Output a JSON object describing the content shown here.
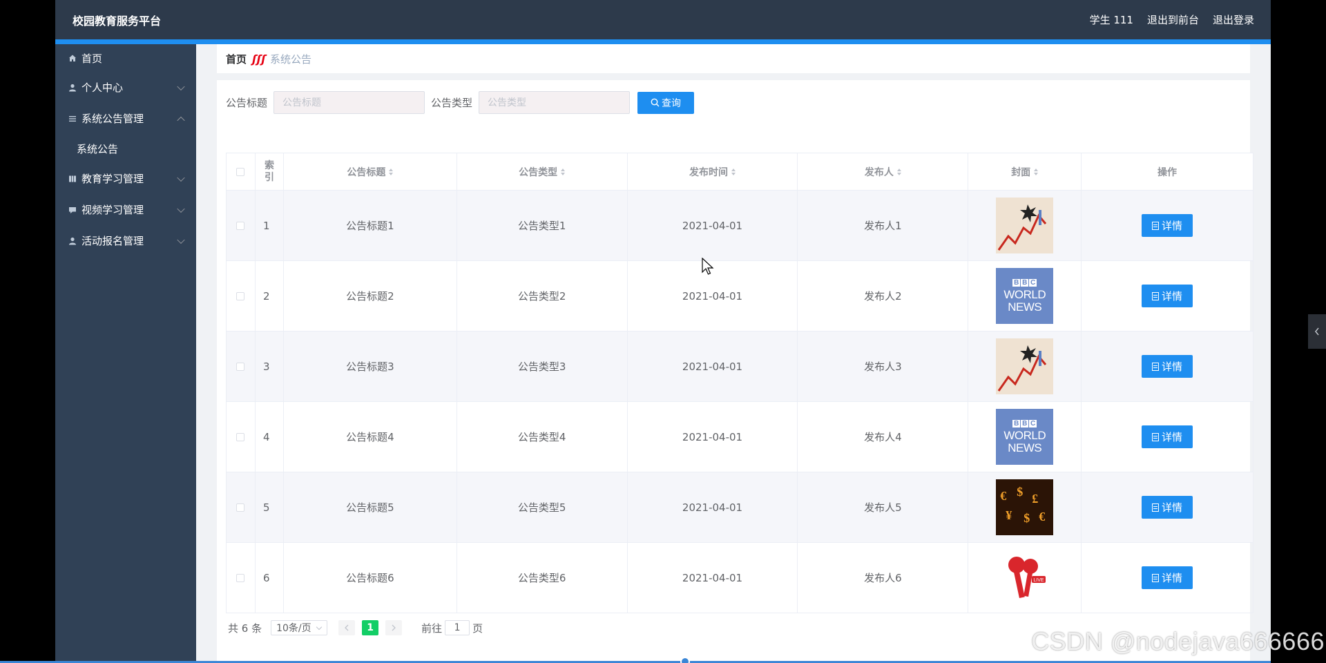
{
  "header": {
    "title": "校园教育服务平台",
    "user": "学生 111",
    "back_to_front": "退出到前台",
    "logout": "退出登录"
  },
  "sidebar": {
    "items": [
      {
        "label": "首页",
        "icon": "home-icon"
      },
      {
        "label": "个人中心",
        "icon": "user-icon",
        "expanded": false
      },
      {
        "label": "系统公告管理",
        "icon": "list-icon",
        "expanded": true,
        "children": [
          {
            "label": "系统公告"
          }
        ]
      },
      {
        "label": "教育学习管理",
        "icon": "grid-icon",
        "expanded": false
      },
      {
        "label": "视频学习管理",
        "icon": "comment-icon",
        "expanded": false
      },
      {
        "label": "活动报名管理",
        "icon": "user-icon",
        "expanded": false
      }
    ]
  },
  "breadcrumb": {
    "home": "首页",
    "separator": "ʃʃʃ",
    "current": "系统公告"
  },
  "search": {
    "title_label": "公告标题",
    "title_placeholder": "公告标题",
    "type_label": "公告类型",
    "type_placeholder": "公告类型",
    "query_button": "查询"
  },
  "table": {
    "headers": [
      "索引",
      "公告标题",
      "公告类型",
      "发布时间",
      "发布人",
      "封面",
      "操作"
    ],
    "index_header_lines": [
      "索",
      "引"
    ],
    "rows": [
      {
        "index": "1",
        "title": "公告标题1",
        "type": "公告类型1",
        "time": "2021-04-01",
        "publisher": "发布人1",
        "cover": "stock-chart-image",
        "action": "详情"
      },
      {
        "index": "2",
        "title": "公告标题2",
        "type": "公告类型2",
        "time": "2021-04-01",
        "publisher": "发布人2",
        "cover": "bbc-world-news-image",
        "action": "详情"
      },
      {
        "index": "3",
        "title": "公告标题3",
        "type": "公告类型3",
        "time": "2021-04-01",
        "publisher": "发布人3",
        "cover": "stock-chart-image",
        "action": "详情"
      },
      {
        "index": "4",
        "title": "公告标题4",
        "type": "公告类型4",
        "time": "2021-04-01",
        "publisher": "发布人4",
        "cover": "bbc-world-news-image",
        "action": "详情"
      },
      {
        "index": "5",
        "title": "公告标题5",
        "type": "公告类型5",
        "time": "2021-04-01",
        "publisher": "发布人5",
        "cover": "currency-symbols-image",
        "action": "详情"
      },
      {
        "index": "6",
        "title": "公告标题6",
        "type": "公告类型6",
        "time": "2021-04-01",
        "publisher": "发布人6",
        "cover": "live-microphone-image",
        "action": "详情"
      }
    ]
  },
  "cover_text": {
    "bbc": [
      "B",
      "B",
      "C"
    ],
    "world": "WORLD",
    "news": "NEWS",
    "live": "LIVE"
  },
  "pagination": {
    "total": "共 6 条",
    "page_size": "10条/页",
    "current_page": "1",
    "goto_prefix": "前往",
    "goto_value": "1",
    "goto_suffix": "页"
  },
  "watermark": "CSDN @nodejava666666",
  "colors": {
    "header_bg": "#2d3a4b",
    "sidebar_bg": "#304156",
    "primary": "#1e8ef0",
    "page_active": "#13ce66"
  }
}
